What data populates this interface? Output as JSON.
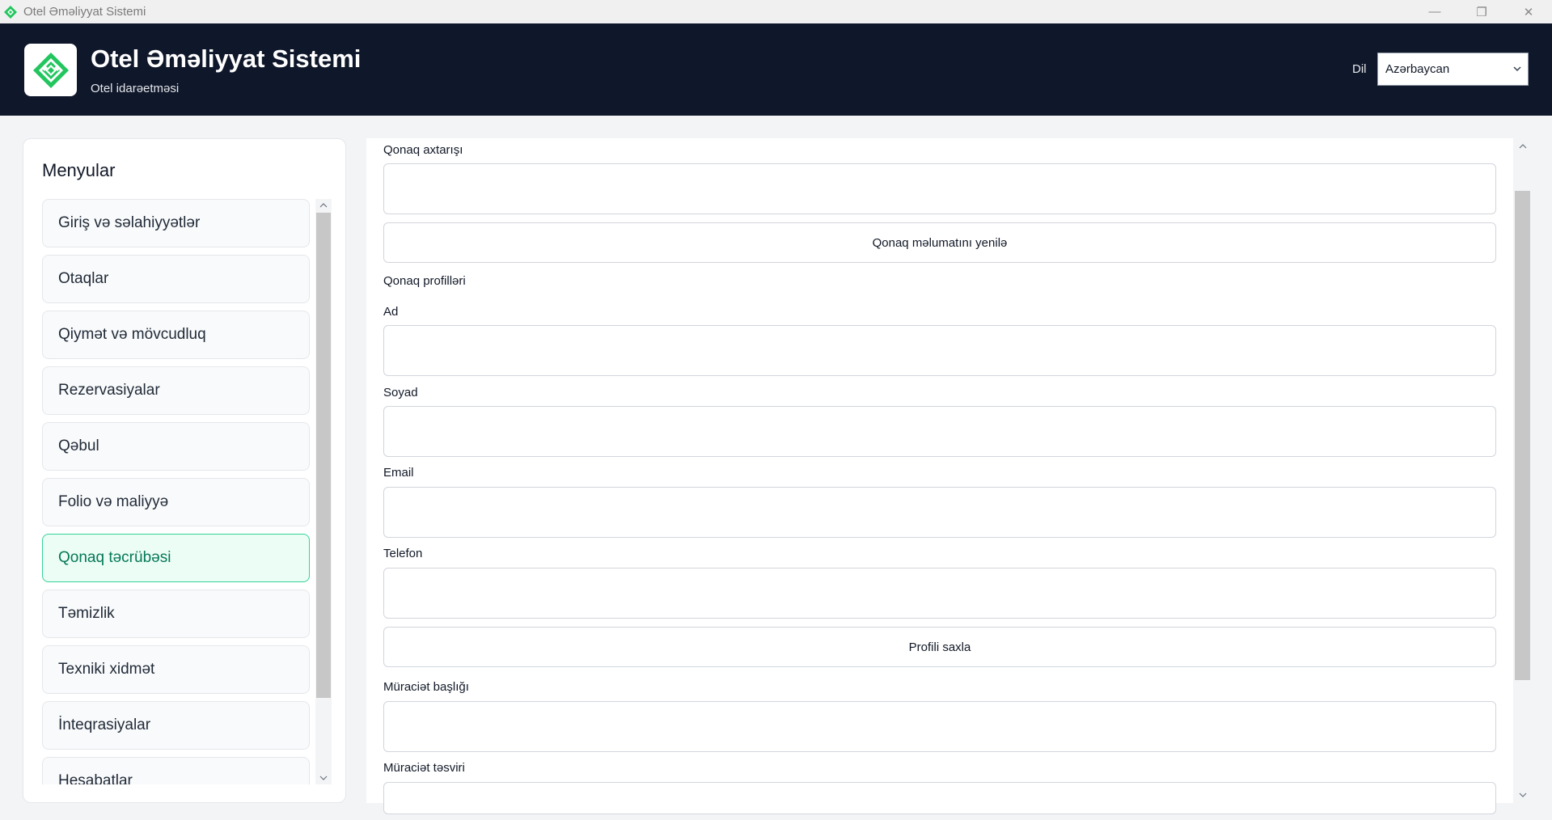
{
  "window": {
    "title": "Otel Əməliyyat Sistemi",
    "controls": [
      "—",
      "❐",
      "✕"
    ]
  },
  "header": {
    "title": "Otel Əməliyyat Sistemi",
    "subtitle": "Otel idarəetməsi",
    "language_label": "Dil",
    "language_value": "Azərbaycan",
    "brand_color": "#0f172a",
    "accent_color": "#22c55e"
  },
  "sidebar": {
    "title": "Menyular",
    "items": [
      {
        "label": "Giriş və səlahiyyətlər"
      },
      {
        "label": "Otaqlar"
      },
      {
        "label": "Qiymət və mövcudluq"
      },
      {
        "label": "Rezervasiyalar"
      },
      {
        "label": "Qəbul"
      },
      {
        "label": "Folio və maliyyə"
      },
      {
        "label": "Qonaq təcrübəsi",
        "active": true
      },
      {
        "label": "Təmizlik"
      },
      {
        "label": "Texniki xidmət"
      },
      {
        "label": "İnteqrasiyalar"
      },
      {
        "label": "Hesabatlar"
      }
    ]
  },
  "main": {
    "search_label": "Qonaq axtarışı",
    "search_value": "",
    "refresh_button": "Qonaq məlumatını yenilə",
    "profiles_section": "Qonaq profilləri",
    "first_name_label": "Ad",
    "first_name_value": "",
    "last_name_label": "Soyad",
    "last_name_value": "",
    "email_label": "Email",
    "email_value": "",
    "phone_label": "Telefon",
    "phone_value": "",
    "save_profile_button": "Profili saxla",
    "request_title_label": "Müraciət başlığı",
    "request_title_value": "",
    "request_description_label": "Müraciət təsviri",
    "request_description_value": ""
  }
}
